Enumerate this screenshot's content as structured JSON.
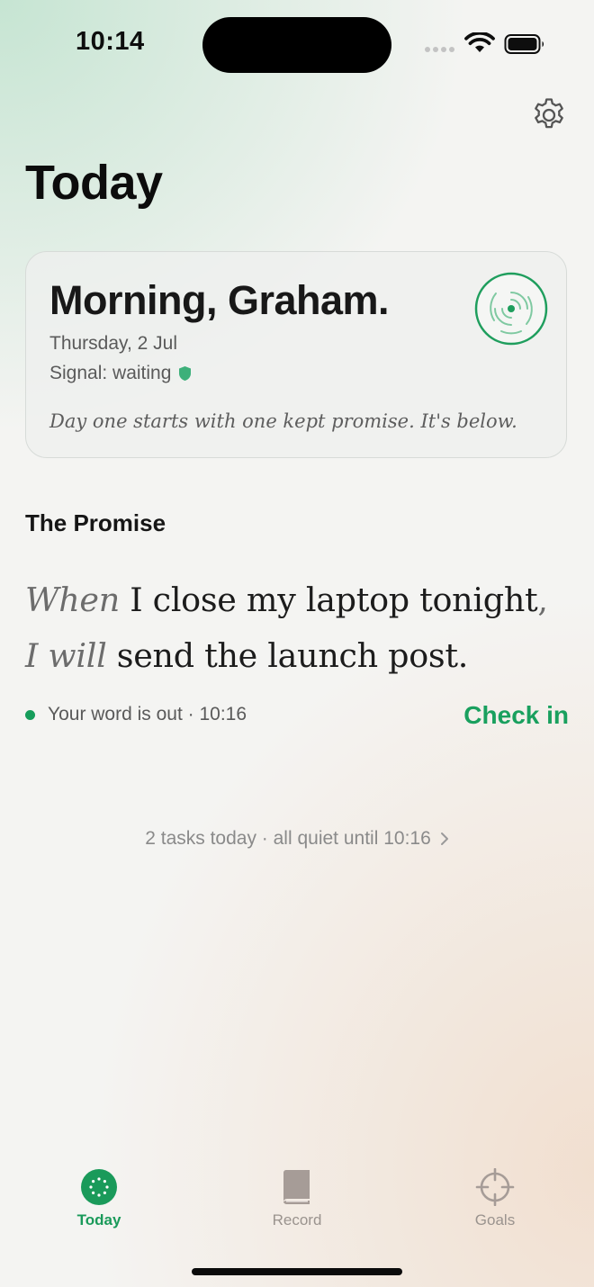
{
  "status_bar": {
    "time": "10:14",
    "icons": [
      "cellular-dots-icon",
      "wifi-icon",
      "battery-icon"
    ]
  },
  "header": {
    "title": "Today",
    "settings_icon": "gear-icon"
  },
  "greeting_card": {
    "greeting": "Morning, Graham.",
    "date": "Thursday, 2 Jul",
    "signal_text": "Signal: waiting",
    "quote": "Day one starts with one kept promise. It's below.",
    "badge_icon": "radar-icon"
  },
  "promise": {
    "section_title": "The Promise",
    "when_keyword": "When",
    "trigger": "I close my laptop tonight",
    "separator": ",",
    "will_keyword": "I will",
    "action": "send the launch post.",
    "status_text": "Your word is out · 10:16",
    "check_in_label": "Check in"
  },
  "summary": {
    "text": "2 tasks today · all quiet until 10:16"
  },
  "tab_bar": {
    "items": [
      {
        "label": "Today",
        "icon": "today-icon",
        "active": true
      },
      {
        "label": "Record",
        "icon": "book-icon",
        "active": false
      },
      {
        "label": "Goals",
        "icon": "crosshair-icon",
        "active": false
      }
    ]
  },
  "colors": {
    "accent": "#19a05e",
    "text_primary": "#141414",
    "text_secondary": "#5a5a5a",
    "tab_inactive": "#9a938e"
  }
}
